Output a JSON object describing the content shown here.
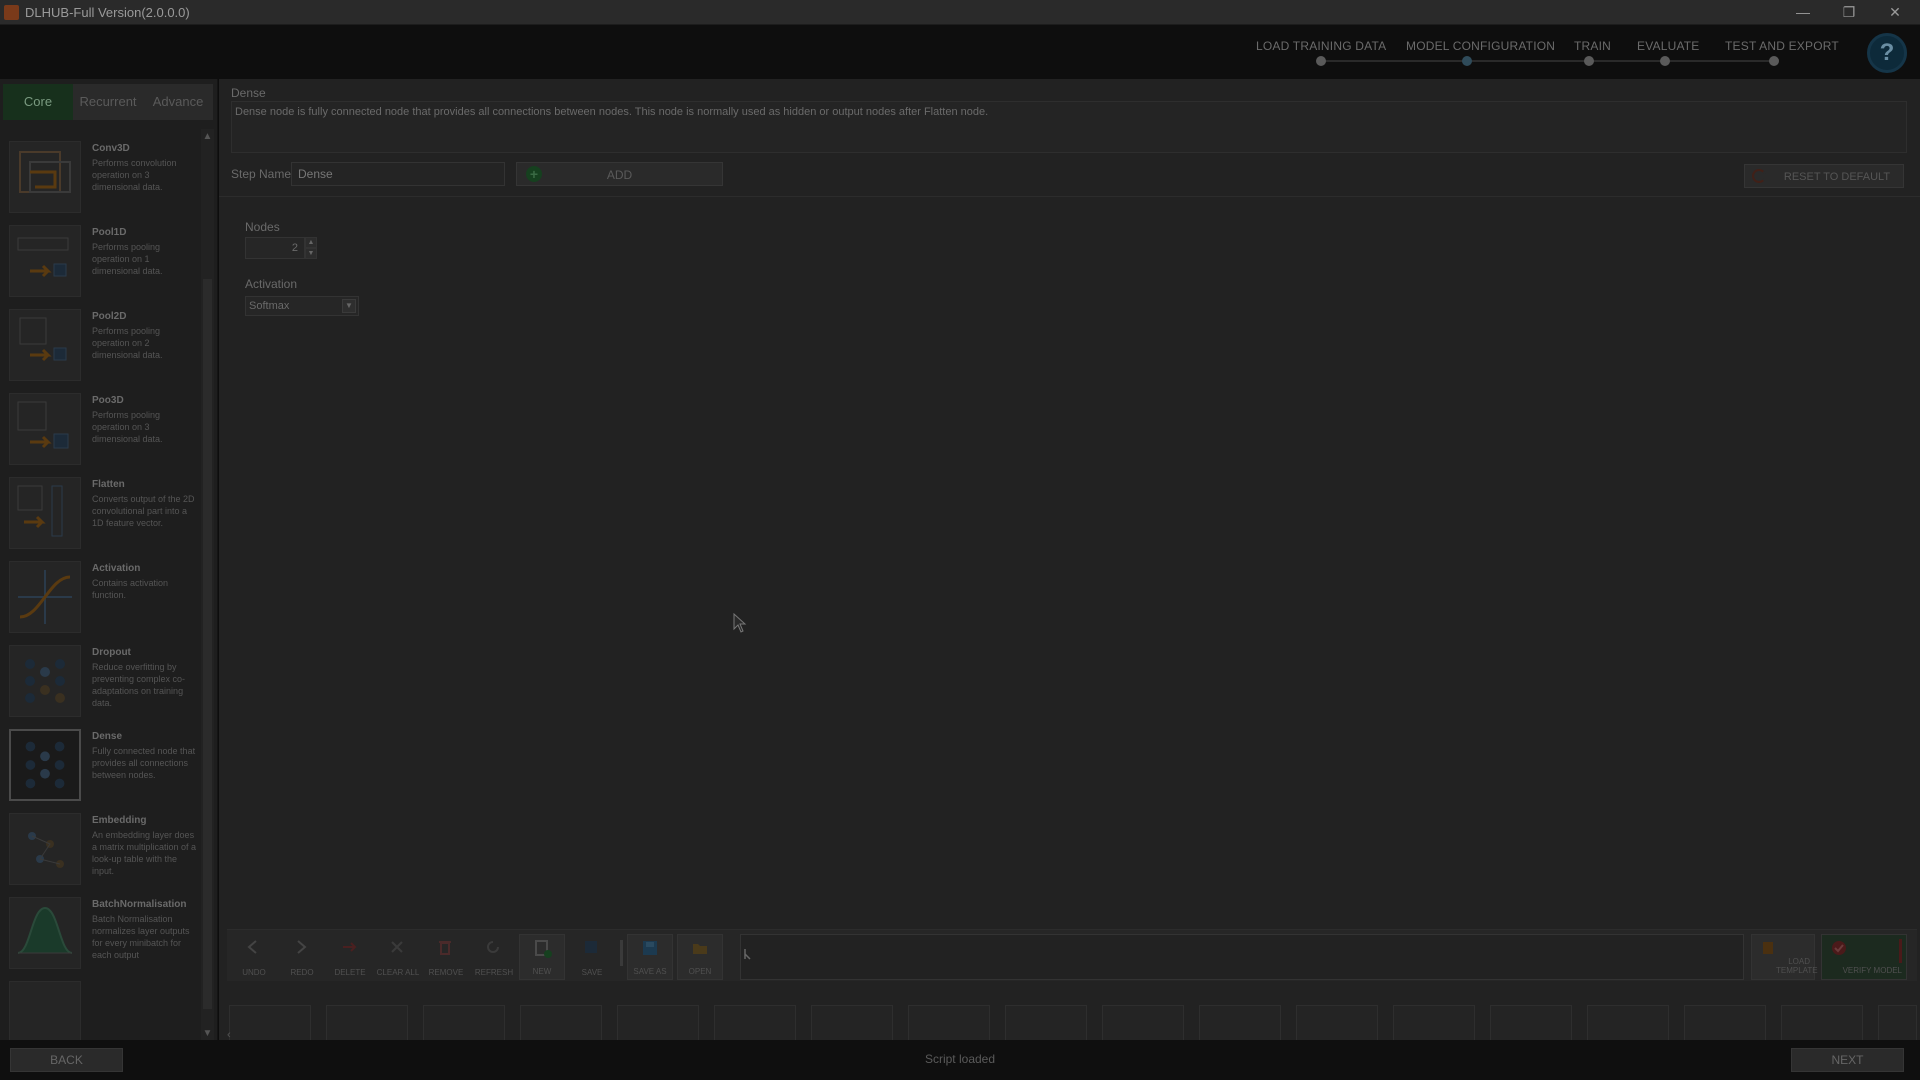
{
  "window": {
    "title": "DLHUB-Full Version(2.0.0.0)",
    "min_glyph": "—",
    "max_glyph": "❐",
    "close_glyph": "✕"
  },
  "steps": [
    {
      "label": "LOAD TRAINING DATA"
    },
    {
      "label": "MODEL CONFIGURATION"
    },
    {
      "label": "TRAIN"
    },
    {
      "label": "EVALUATE"
    },
    {
      "label": "TEST AND EXPORT"
    }
  ],
  "help_glyph": "?",
  "tabs": [
    {
      "label": "Core",
      "active": true
    },
    {
      "label": "Recurrent",
      "active": false
    },
    {
      "label": "Advance",
      "active": false
    }
  ],
  "layers": [
    {
      "name": "Conv3D",
      "desc": "Performs convolution operation on 3 dimensional data.",
      "icon": "conv3d-icon"
    },
    {
      "name": "Pool1D",
      "desc": "Performs pooling operation on 1 dimensional data.",
      "icon": "pool1d-icon"
    },
    {
      "name": "Pool2D",
      "desc": "Performs pooling operation on 2 dimensional data.",
      "icon": "pool2d-icon"
    },
    {
      "name": "Poo3D",
      "desc": "Performs pooling operation on 3 dimensional data.",
      "icon": "pool3d-icon"
    },
    {
      "name": "Flatten",
      "desc": "Converts output of the 2D convolutional part into a 1D feature vector.",
      "icon": "flatten-icon"
    },
    {
      "name": "Activation",
      "desc": "Contains activation function.",
      "icon": "activation-icon"
    },
    {
      "name": "Dropout",
      "desc": "Reduce overfitting by preventing complex co-adaptations on training data.",
      "icon": "dropout-icon"
    },
    {
      "name": "Dense",
      "desc": "Fully connected node that provides all connections between nodes.",
      "icon": "dense-icon",
      "selected": true
    },
    {
      "name": "Embedding",
      "desc": "An embedding layer does a matrix multiplication of a look-up table with the input.",
      "icon": "embedding-icon"
    },
    {
      "name": "BatchNormalisation",
      "desc": "Batch Normalisation normalizes layer outputs for every minibatch for each output",
      "icon": "batchnorm-icon"
    }
  ],
  "layer_detail": {
    "title": "Dense",
    "description": "Dense node is fully connected node that provides all connections between nodes. This node is normally used as hidden or output nodes after Flatten node.",
    "step_name_label": "Step Name",
    "step_name_value": "Dense",
    "add_label": "ADD",
    "reset_label": "RESET TO DEFAULT"
  },
  "params": {
    "nodes_label": "Nodes",
    "nodes_value": "2",
    "activation_label": "Activation",
    "activation_value": "Softmax"
  },
  "toolbar": {
    "tools": [
      {
        "label": "UNDO",
        "icon": "undo-icon",
        "enabled": false
      },
      {
        "label": "REDO",
        "icon": "redo-icon",
        "enabled": false
      },
      {
        "label": "DELETE",
        "icon": "delete-icon",
        "enabled": false
      },
      {
        "label": "CLEAR ALL",
        "icon": "clear-all-icon",
        "enabled": false
      },
      {
        "label": "REMOVE",
        "icon": "trash-icon",
        "enabled": false
      },
      {
        "label": "REFRESH",
        "icon": "refresh-icon",
        "enabled": false
      },
      {
        "label": "NEW",
        "icon": "new-file-icon",
        "enabled": true
      },
      {
        "label": "SAVE",
        "icon": "save-icon",
        "enabled": false
      },
      {
        "label": "SAVE AS",
        "icon": "save-as-icon",
        "enabled": true
      },
      {
        "label": "OPEN",
        "icon": "folder-open-icon",
        "enabled": true
      }
    ],
    "load_template_label": "LOAD TEMPLATE",
    "verify_model_label": "VERIFY MODEL"
  },
  "bottom": {
    "back_label": "BACK",
    "next_label": "NEXT",
    "status_text": "Script loaded"
  },
  "colors": {
    "active_tab": "#17301c",
    "help": "#0d2a3a",
    "add_plus": "#16401f",
    "background": "#0d0d0d"
  }
}
